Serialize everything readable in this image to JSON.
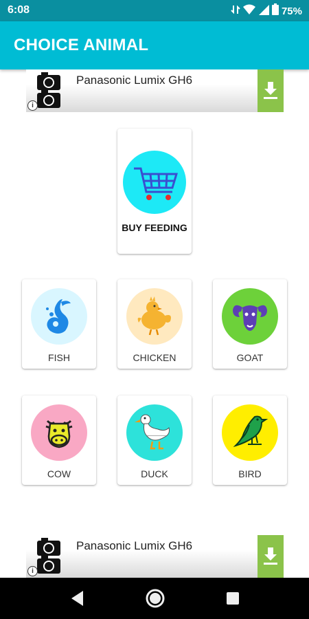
{
  "status_bar": {
    "time": "6:08",
    "battery": "75%"
  },
  "app_bar": {
    "title": "CHOICE ANIMAL"
  },
  "ads": [
    {
      "title": "Panasonic Lumix GH6",
      "info": "i"
    },
    {
      "title": "Panasonic Lumix GH6",
      "info": "i"
    }
  ],
  "buy": {
    "label": "BUY FEEDING",
    "icon": "shopping-cart-icon",
    "color": "#1de9f6"
  },
  "animals": [
    {
      "label": "FISH",
      "icon": "fish-icon",
      "color": "#d9f6ff"
    },
    {
      "label": "CHICKEN",
      "icon": "chicken-icon",
      "color": "#ffe9bf"
    },
    {
      "label": "GOAT",
      "icon": "goat-icon",
      "color": "#6dd13a"
    },
    {
      "label": "COW",
      "icon": "cow-icon",
      "color": "#f9a8c4"
    },
    {
      "label": "DUCK",
      "icon": "duck-icon",
      "color": "#2de2da"
    },
    {
      "label": "BIRD",
      "icon": "bird-icon",
      "color": "#ffee00"
    }
  ],
  "nav": [
    "back-icon",
    "home-icon",
    "recents-icon"
  ]
}
